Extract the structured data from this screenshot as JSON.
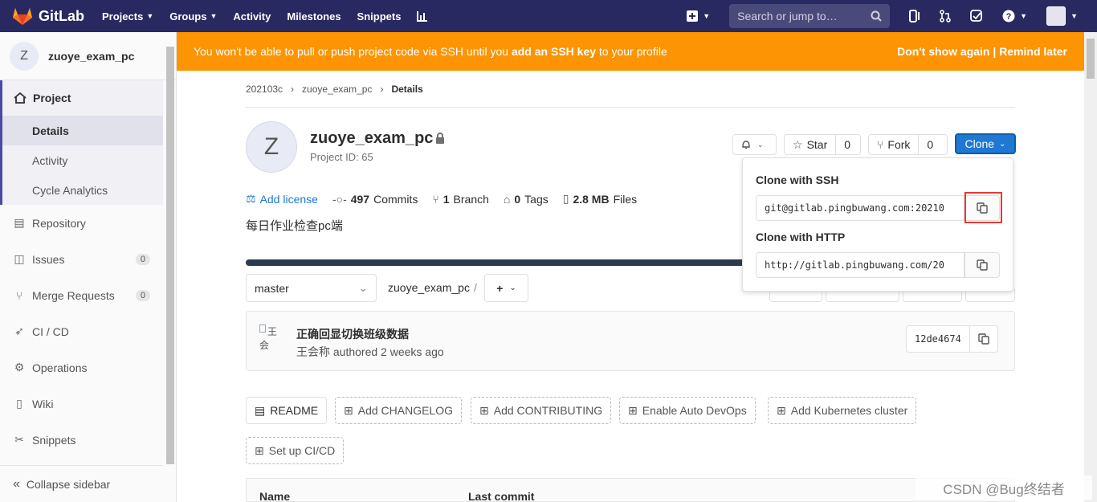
{
  "navbar": {
    "brand": "GitLab",
    "links": [
      {
        "label": "Projects",
        "has_caret": true
      },
      {
        "label": "Groups",
        "has_caret": true
      },
      {
        "label": "Activity",
        "has_caret": false
      },
      {
        "label": "Milestones",
        "has_caret": false
      },
      {
        "label": "Snippets",
        "has_caret": false
      }
    ],
    "search_placeholder": "Search or jump to…"
  },
  "sidebar": {
    "project_initial": "Z",
    "project_name": "zuoye_exam_pc",
    "section_label": "Project",
    "sub_items": [
      "Details",
      "Activity",
      "Cycle Analytics"
    ],
    "items": [
      {
        "label": "Repository",
        "icon": "book-icon",
        "count": ""
      },
      {
        "label": "Issues",
        "icon": "issues-icon",
        "count": "0"
      },
      {
        "label": "Merge Requests",
        "icon": "merge-request-icon",
        "count": "0"
      },
      {
        "label": "CI / CD",
        "icon": "rocket-icon",
        "count": ""
      },
      {
        "label": "Operations",
        "icon": "cloud-gear-icon",
        "count": ""
      },
      {
        "label": "Wiki",
        "icon": "wiki-icon",
        "count": ""
      },
      {
        "label": "Snippets",
        "icon": "snippet-icon",
        "count": ""
      }
    ],
    "collapse_label": "Collapse sidebar"
  },
  "banner": {
    "text_before": "You won't be able to pull or push project code via SSH until you ",
    "link_text": "add an SSH key",
    "text_after": " to your profile",
    "dont_show": "Don't show again",
    "separator": " | ",
    "remind": "Remind later",
    "color": "#fc9403"
  },
  "breadcrumb": [
    "202103c",
    "zuoye_exam_pc",
    "Details"
  ],
  "project": {
    "initial": "Z",
    "name": "zuoye_exam_pc",
    "id_text": "Project ID: 65",
    "description": "每日作业检查pc端"
  },
  "actions": {
    "star_label": "Star",
    "star_count": "0",
    "fork_label": "Fork",
    "fork_count": "0",
    "clone_label": "Clone"
  },
  "stats": {
    "add_license": "Add license",
    "commits_count": "497",
    "commits_label": "Commits",
    "branch_count": "1",
    "branch_label": "Branch",
    "tags_count": "0",
    "tags_label": "Tags",
    "files_size": "2.8 MB",
    "files_label": "Files"
  },
  "repo": {
    "branch": "master",
    "path": "zuoye_exam_pc",
    "separator": "/"
  },
  "commit": {
    "avatar_alt": "王\n会",
    "title": "正确回显切换班级数据",
    "author": "王会称",
    "meta": "authored 2 weeks ago",
    "sha": "12de4674"
  },
  "quick_actions": [
    {
      "label": "README",
      "solid": true
    },
    {
      "label": "Add CHANGELOG",
      "solid": false
    },
    {
      "label": "Add CONTRIBUTING",
      "solid": false
    },
    {
      "label": "Enable Auto DevOps",
      "solid": false
    },
    {
      "label": "Add Kubernetes cluster",
      "solid": false
    },
    {
      "label": "Set up CI/CD",
      "solid": false
    }
  ],
  "table": {
    "col_name": "Name",
    "col_last_commit": "Last commit"
  },
  "clone_dropdown": {
    "ssh_label": "Clone with SSH",
    "ssh_url": "git@gitlab.pingbuwang.com:20210",
    "http_label": "Clone with HTTP",
    "http_url": "http://gitlab.pingbuwang.com/20"
  },
  "watermark": "CSDN @Bug终结者"
}
